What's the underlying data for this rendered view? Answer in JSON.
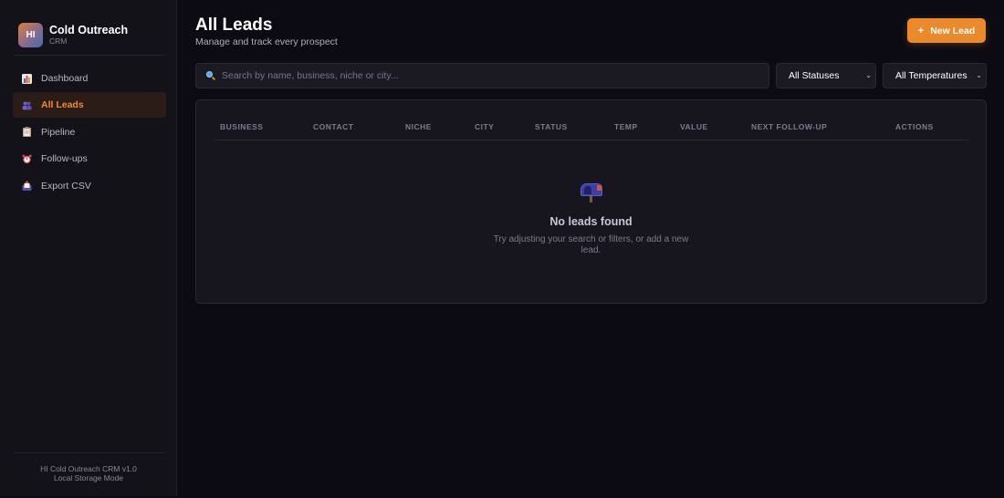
{
  "app": {
    "logo_text": "HI",
    "name": "Cold Outreach",
    "subtitle": "CRM",
    "version_line": "HI Cold Outreach CRM v1.0",
    "mode_line": "Local Storage Mode"
  },
  "sidebar": {
    "items": [
      {
        "label": "Dashboard",
        "icon": "bar-chart-icon",
        "active": false
      },
      {
        "label": "All Leads",
        "icon": "people-icon",
        "active": true
      },
      {
        "label": "Pipeline",
        "icon": "clipboard-icon",
        "active": false
      },
      {
        "label": "Follow-ups",
        "icon": "alarm-clock-icon",
        "active": false
      },
      {
        "label": "Export CSV",
        "icon": "outbox-icon",
        "active": false
      }
    ]
  },
  "header": {
    "title": "All Leads",
    "subtitle": "Manage and track every prospect",
    "new_lead_label": "New Lead",
    "new_lead_plus": "+"
  },
  "filters": {
    "search_placeholder": "Search by name, business, niche or city...",
    "search_value": "",
    "status_selected": "All Statuses",
    "temperature_selected": "All Temperatures"
  },
  "table": {
    "columns": [
      "BUSINESS",
      "CONTACT",
      "NICHE",
      "CITY",
      "STATUS",
      "TEMP",
      "VALUE",
      "NEXT FOLLOW-UP",
      "ACTIONS"
    ],
    "rows": [],
    "empty_title": "No leads found",
    "empty_text": "Try adjusting your search or filters, or add a new lead.",
    "empty_icon": "mailbox-icon"
  },
  "colors": {
    "accent": "#ea8a2c",
    "background": "#0c0b13",
    "sidebar": "#131219",
    "card": "#17161f",
    "active_nav_bg": "#2c1c17",
    "active_nav_text": "#ef8a32"
  }
}
